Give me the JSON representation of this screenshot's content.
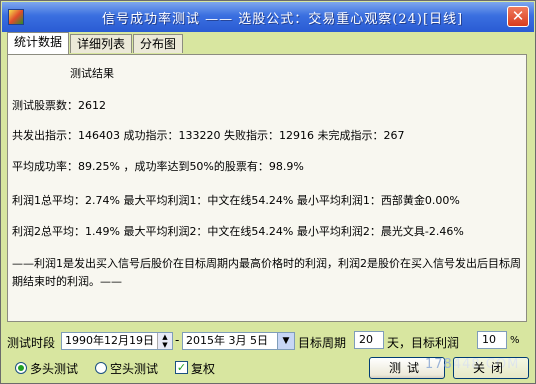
{
  "window": {
    "title": "信号成功率测试 —— 选股公式：交易重心观察(24)[日线]",
    "close_glyph": "✕"
  },
  "tabs": [
    "统计数据",
    "详细列表",
    "分布图"
  ],
  "results": {
    "heading": "测试结果",
    "line1": "测试股票数：2612",
    "line2": "共发出指示：146403 成功指示：133220 失败指示：12916 未完成指示：267",
    "line3": "平均成功率：89.25% ，成功率达到50%的股票有：98.9%",
    "line4": "利润1总平均：2.74%   最大平均利润1：中文在线54.24%  最小平均利润1：西部黄金0.00%",
    "line5": "利润2总平均：1.49%   最大平均利润2：中文在线54.24%  最小平均利润2：晨光文具-2.46%",
    "note": "——利润1是发出买入信号后股价在目标周期内最高价格时的利润，利润2是股价在买入信号发出后目标周期结束时的利润。——"
  },
  "controls": {
    "period_label": "测试时段",
    "start_date": "1990年12月19日",
    "dash": "-",
    "end_date": "2015年 3月 5日",
    "target_period_label": "目标周期",
    "target_period_value": "20",
    "days_target_profit_label": "天，目标利润",
    "target_profit_value": "10",
    "percent_sign": "%",
    "long_test_label": "多头测试",
    "short_test_label": "空头测试",
    "restore_label": "复权",
    "test_button": "测试",
    "close_button": "关闭",
    "long_test_selected": true,
    "restore_checked": true
  },
  "watermark": "178448.COM"
}
